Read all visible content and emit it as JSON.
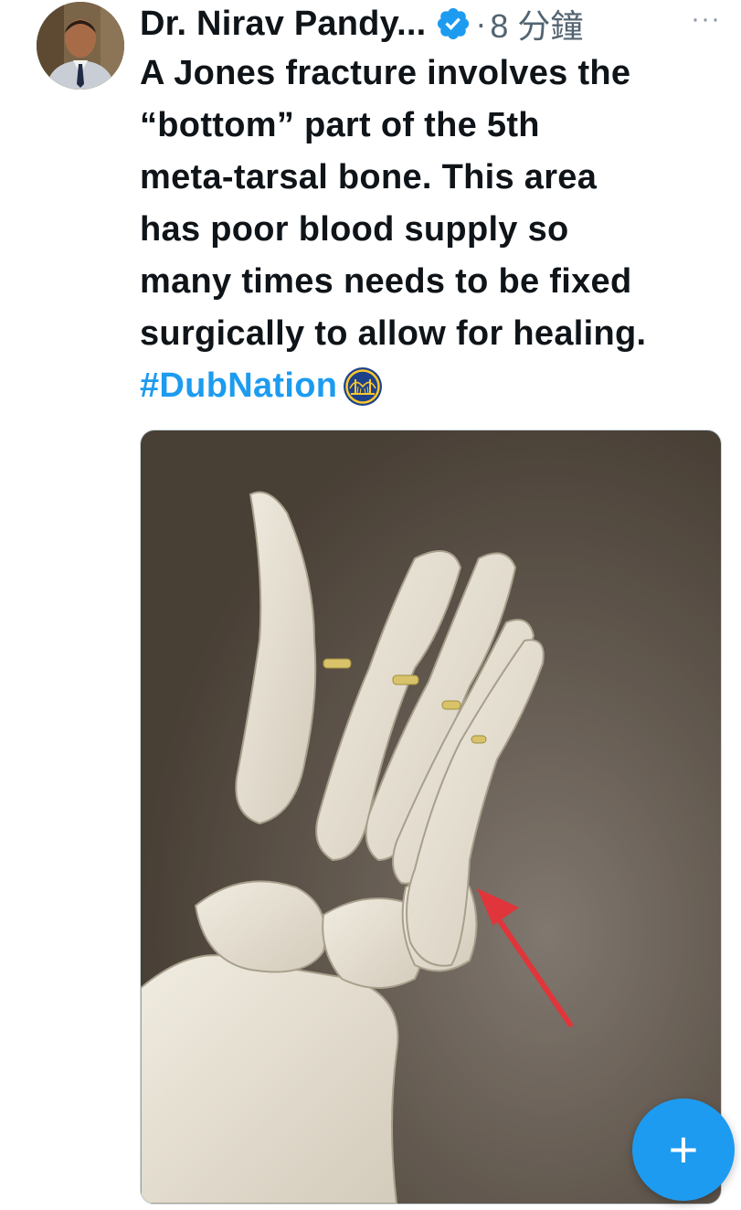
{
  "tweet": {
    "author_name": "Dr. Nirav Pandy...",
    "separator": "·",
    "timestamp": "8 分鐘",
    "more_label": "···",
    "text_lines": [
      "A Jones fracture involves the",
      "“bottom” part of the 5th",
      "meta-tarsal bone. This area",
      "has poor blood supply so",
      "many times needs to be fixed",
      "surgically to allow for healing."
    ],
    "hashtag": "#DubNation",
    "verified_icon": "verified-badge-icon",
    "hashtag_emoji": "golden-state-warriors-logo-icon"
  },
  "compose_button": {
    "label": "+",
    "color": "#1d9bf0"
  },
  "colors": {
    "accent": "#1d9bf0",
    "text": "#0f1419",
    "muted": "#536471"
  }
}
